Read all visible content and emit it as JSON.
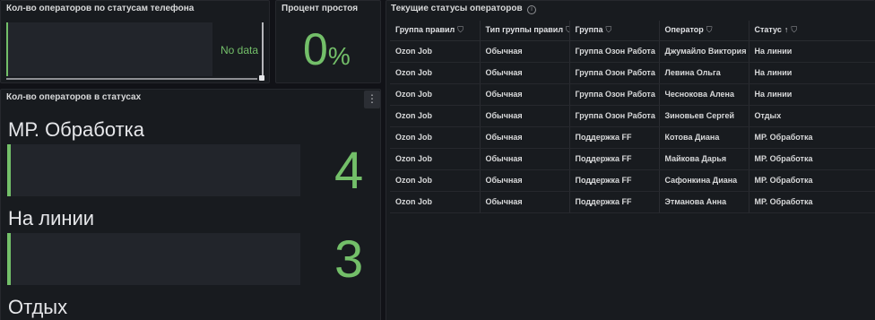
{
  "panel_phone": {
    "title": "Кол-во операторов по статусам телефона",
    "no_data": "No data"
  },
  "panel_idle": {
    "title": "Процент простоя",
    "value": "0",
    "unit": "%"
  },
  "panel_status": {
    "title": "Кол-во операторов в статусах",
    "menu_icon": "⋮",
    "items": [
      {
        "label": "МР. Обработка",
        "value": "4"
      },
      {
        "label": "На линии",
        "value": "3"
      },
      {
        "label": "Отдых",
        "value": ""
      }
    ]
  },
  "panel_table": {
    "title": "Текущие статусы операторов",
    "info_icon": "i",
    "columns": [
      "Группа правил",
      "Тип группы правил",
      "Группа",
      "Оператор",
      "Статус"
    ],
    "filter_icon": "⛉",
    "sort_icon": "↑",
    "rows": [
      [
        "Ozon Job",
        "Обычная",
        "Группа Озон Работа",
        "Джумайло Виктория",
        "На линии"
      ],
      [
        "Ozon Job",
        "Обычная",
        "Группа Озон Работа",
        "Левина Ольга",
        "На линии"
      ],
      [
        "Ozon Job",
        "Обычная",
        "Группа Озон Работа",
        "Чеснокова Алена",
        "На линии"
      ],
      [
        "Ozon Job",
        "Обычная",
        "Группа Озон Работа",
        "Зиновьев Сергей",
        "Отдых"
      ],
      [
        "Ozon Job",
        "Обычная",
        "Поддержка FF",
        "Котова Диана",
        "МР. Обработка"
      ],
      [
        "Ozon Job",
        "Обычная",
        "Поддержка FF",
        "Майкова Дарья",
        "МР. Обработка"
      ],
      [
        "Ozon Job",
        "Обычная",
        "Поддержка FF",
        "Сафонкина Диана",
        "МР. Обработка"
      ],
      [
        "Ozon Job",
        "Обычная",
        "Поддержка FF",
        "Этманова Анна",
        "МР. Обработка"
      ]
    ]
  }
}
